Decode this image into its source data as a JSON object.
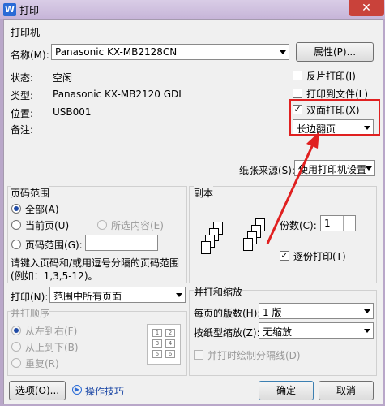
{
  "title": "打印",
  "title_icon": "W",
  "colors": {
    "highlight": "#e02020",
    "accent": "#1f4aa6"
  },
  "printer": {
    "section": "打印机",
    "name_label": "名称(M):",
    "name_value": "Panasonic KX-MB2128CN",
    "properties_button": "属性(P)...",
    "status_label": "状态:",
    "status_value": "空闲",
    "type_label": "类型:",
    "type_value": "Panasonic KX-MB2120 GDI",
    "location_label": "位置:",
    "location_value": "USB001",
    "comment_label": "备注:",
    "reverse_print": "反片打印(I)",
    "print_to_file": "打印到文件(L)",
    "duplex_print": "双面打印(X)",
    "duplex_mode": "长边翻页",
    "paper_source_label": "纸张来源(S):",
    "paper_source_value": "使用打印机设置"
  },
  "range": {
    "section": "页码范围",
    "all": "全部(A)",
    "current": "当前页(U)",
    "selection": "所选内容(E)",
    "pages": "页码范围(G):",
    "hint1": "请键入页码和/或用逗号分隔的页码范围",
    "hint2": "(例如：1,3,5-12)。"
  },
  "copies": {
    "section": "副本",
    "count_label": "份数(C):",
    "count_value": "1",
    "collate": "逐份打印(T)"
  },
  "print_what": {
    "label": "打印(N):",
    "value": "范围中所有页面",
    "order_title": "并打顺序",
    "order_lr": "从左到右(F)",
    "order_tb": "从上到下(B)",
    "order_repeat": "重复(R)"
  },
  "zoom": {
    "section": "并打和缩放",
    "pages_per_sheet_label": "每页的版数(H):",
    "pages_per_sheet_value": "1 版",
    "scale_label": "按纸型缩放(Z):",
    "scale_value": "无缩放",
    "draw_borders": "并打时绘制分隔线(D)"
  },
  "footer": {
    "options": "选项(O)...",
    "tips": "操作技巧",
    "ok": "确定",
    "cancel": "取消"
  }
}
